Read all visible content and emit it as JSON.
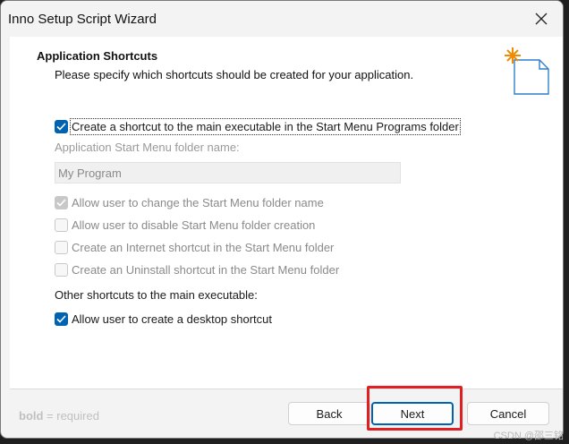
{
  "window": {
    "title": "Inno Setup Script Wizard"
  },
  "header": {
    "heading": "Application Shortcuts",
    "subheading": "Please specify which shortcuts should be created for your application."
  },
  "options": {
    "start_menu": {
      "label": "Create a shortcut to the main executable in the Start Menu Programs folder",
      "checked": true
    },
    "folder_caption": "Application Start Menu folder name:",
    "folder_value": "My Program",
    "allow_change": {
      "label": "Allow user to change the Start Menu folder name",
      "checked": true,
      "enabled": false
    },
    "allow_disable": {
      "label": "Allow user to disable Start Menu folder creation",
      "checked": false,
      "enabled": false
    },
    "internet_shortcut": {
      "label": "Create an Internet shortcut in the Start Menu folder",
      "checked": false,
      "enabled": false
    },
    "uninstall_shortcut": {
      "label": "Create an Uninstall shortcut in the Start Menu folder",
      "checked": false,
      "enabled": false
    },
    "other_caption": "Other shortcuts to the main executable:",
    "desktop_shortcut": {
      "label": "Allow user to create a desktop shortcut",
      "checked": true
    }
  },
  "footer": {
    "note_bold": "bold",
    "note_rest": " = required",
    "back_label": "Back",
    "next_label": "Next",
    "cancel_label": "Cancel"
  },
  "watermark": "CSDN @邵三铭",
  "colors": {
    "accent": "#0063b1",
    "highlight": "#e02020"
  }
}
